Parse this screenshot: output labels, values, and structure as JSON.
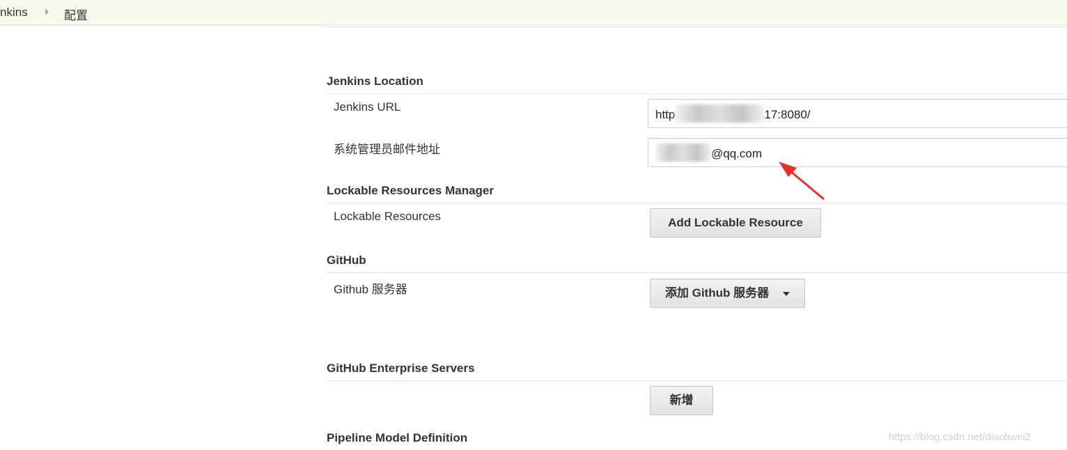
{
  "breadcrumb": {
    "items": [
      "nkins",
      "配置"
    ]
  },
  "sections": {
    "jenkins_location": {
      "title": "Jenkins Location",
      "url_label": "Jenkins URL",
      "url_value_prefix": "http",
      "url_value_suffix": "17:8080/",
      "email_label": "系统管理员邮件地址",
      "email_value_suffix": "@qq.com"
    },
    "lockable": {
      "title": "Lockable Resources Manager",
      "label": "Lockable Resources",
      "button": "Add Lockable Resource"
    },
    "github": {
      "title": "GitHub",
      "label": "Github 服务器",
      "button": "添加 Github 服务器"
    },
    "github_enterprise": {
      "title": "GitHub Enterprise Servers",
      "button": "新增"
    },
    "pipeline": {
      "title": "Pipeline Model Definition"
    }
  },
  "annotation": {
    "arrow_color": "#e8302a"
  },
  "watermark": "https://blog.csdn.net/diaoliwei2"
}
